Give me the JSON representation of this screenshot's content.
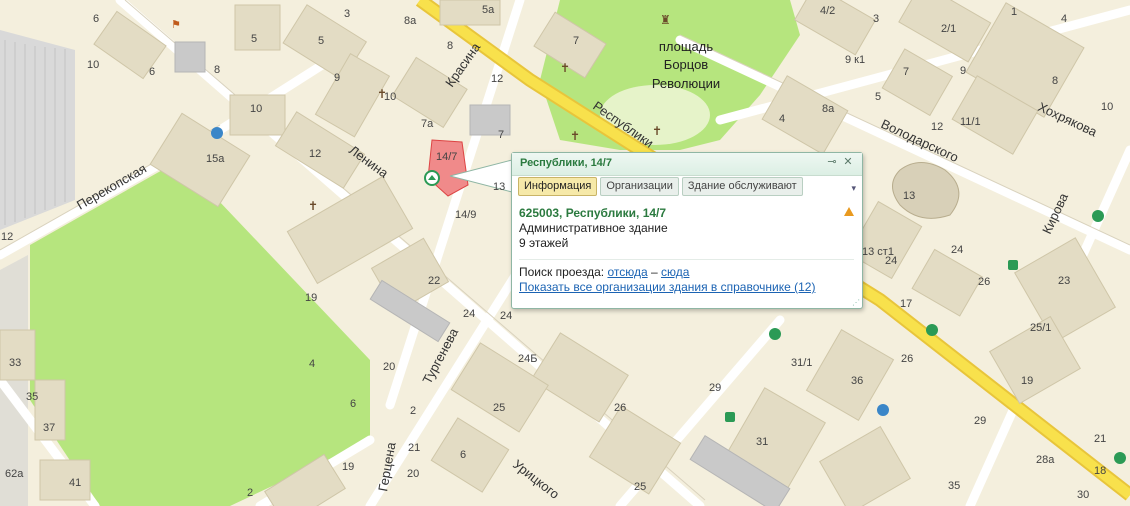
{
  "map": {
    "streets": [
      {
        "text": "Перекопская"
      },
      {
        "text": "Ленина"
      },
      {
        "text": "Красина"
      },
      {
        "text": "Республики"
      },
      {
        "text": "Володарского"
      },
      {
        "text": "Хохрякова"
      },
      {
        "text": "Кирова"
      },
      {
        "text": "Тургенева"
      },
      {
        "text": "Герцена"
      },
      {
        "text": "Урицкого"
      }
    ],
    "square": [
      "площадь",
      "Борцов",
      "Революции"
    ],
    "numbers": [
      "3",
      "5",
      "6",
      "8",
      "10",
      "10",
      "9",
      "10",
      "8",
      "12",
      "15а",
      "12",
      "14/7",
      "7а",
      "7",
      "14/9",
      "13",
      "22",
      "19",
      "4",
      "20",
      "6",
      "33",
      "35",
      "37",
      "62а",
      "41",
      "2",
      "21",
      "19",
      "6",
      "25",
      "26",
      "24Б",
      "24",
      "25",
      "29",
      "31",
      "31/1",
      "36",
      "26",
      "24",
      "17",
      "13",
      "13 ст1",
      "24",
      "26",
      "23",
      "25/1",
      "19",
      "29",
      "21",
      "28а",
      "30",
      "35",
      "8а",
      "5а",
      "7",
      "9 к1",
      "5",
      "7",
      "3",
      "4/2",
      "2/1",
      "1",
      "4",
      "9",
      "8",
      "10",
      "11/1",
      "12",
      "5",
      "4",
      "8а",
      "12",
      "18",
      "6",
      "2",
      "24",
      "20",
      "6"
    ]
  },
  "popup": {
    "title": "Республики, 14/7",
    "tabs": [
      "Информация",
      "Организации",
      "Здание обслуживают"
    ],
    "active_tab": "Информация",
    "address": "625003, Республики, 14/7",
    "type": "Административное здание",
    "floors": "9 этажей",
    "route_label": "Поиск проезда:",
    "route_from": "отсюда",
    "route_dash": "–",
    "route_to": "сюда",
    "all_orgs_link": "Показать все организации здания в справочнике (12)"
  }
}
